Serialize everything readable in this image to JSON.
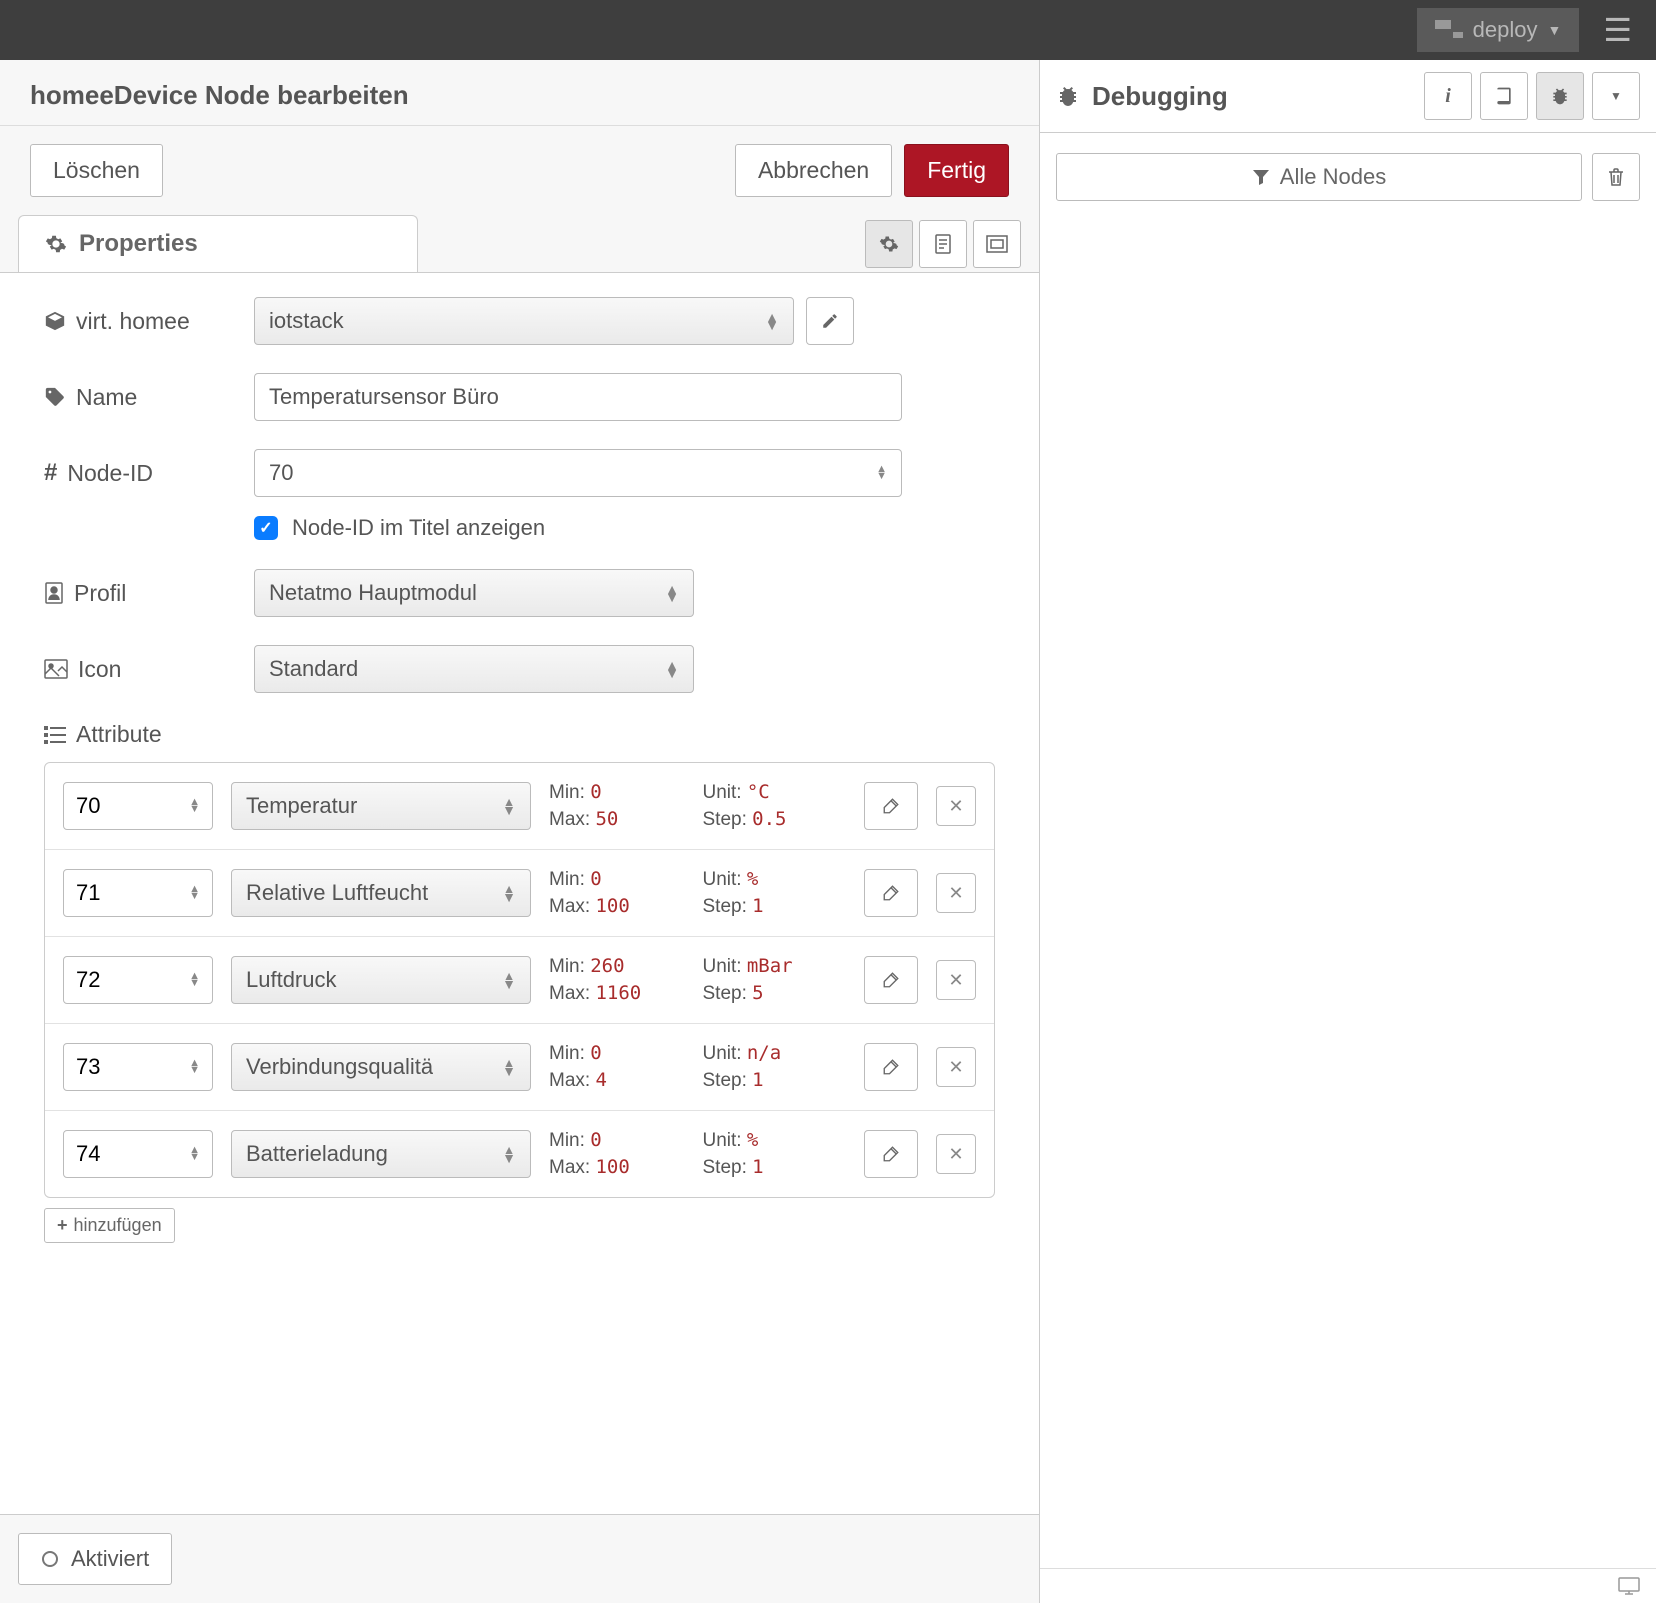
{
  "topbar": {
    "deploy_label": "deploy"
  },
  "editor": {
    "title": "homeeDevice Node bearbeiten",
    "delete_label": "Löschen",
    "cancel_label": "Abbrechen",
    "done_label": "Fertig",
    "properties_tab": "Properties"
  },
  "fields": {
    "virt_homee_label": "virt. homee",
    "virt_homee_value": "iotstack",
    "name_label": "Name",
    "name_value": "Temperatursensor Büro",
    "nodeid_label": "Node-ID",
    "nodeid_value": "70",
    "show_nodeid_label": "Node-ID im Titel anzeigen",
    "show_nodeid_checked": true,
    "profile_label": "Profil",
    "profile_value": "Netatmo Hauptmodul",
    "icon_label": "Icon",
    "icon_value": "Standard",
    "attributes_label": "Attribute",
    "add_label": "hinzufügen",
    "activated_label": "Aktiviert"
  },
  "meta_labels": {
    "min": "Min:",
    "max": "Max:",
    "unit": "Unit:",
    "step": "Step:"
  },
  "attributes": [
    {
      "id": "70",
      "type": "Temperatur",
      "min": "0",
      "max": "50",
      "unit": "°C",
      "step": "0.5"
    },
    {
      "id": "71",
      "type": "Relative Luftfeucht",
      "min": "0",
      "max": "100",
      "unit": "%",
      "step": "1"
    },
    {
      "id": "72",
      "type": "Luftdruck",
      "min": "260",
      "max": "1160",
      "unit": "mBar",
      "step": "5"
    },
    {
      "id": "73",
      "type": "Verbindungsqualitä",
      "min": "0",
      "max": "4",
      "unit": "n/a",
      "step": "1"
    },
    {
      "id": "74",
      "type": "Batterieladung",
      "min": "0",
      "max": "100",
      "unit": "%",
      "step": "1"
    }
  ],
  "sidebar": {
    "title": "Debugging",
    "filter_label": "Alle Nodes"
  }
}
